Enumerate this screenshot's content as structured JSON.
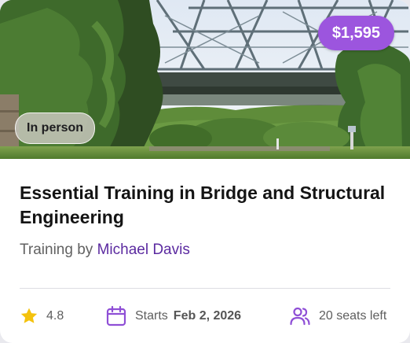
{
  "course": {
    "price": "$1,595",
    "format": "In person",
    "title": "Essential Training in Bridge and Structural Engineering",
    "byline_prefix": "Training by",
    "instructor": "Michael Davis",
    "rating": "4.8",
    "starts_label": "Starts",
    "start_date": "Feb 2, 2026",
    "seats": "20 seats left"
  },
  "icons": {
    "rating": "star-icon",
    "start": "calendar-icon",
    "seats": "users-icon"
  },
  "colors": {
    "accent": "#9c55de",
    "instructor": "#5b2aa0",
    "star": "#f4c20d"
  }
}
